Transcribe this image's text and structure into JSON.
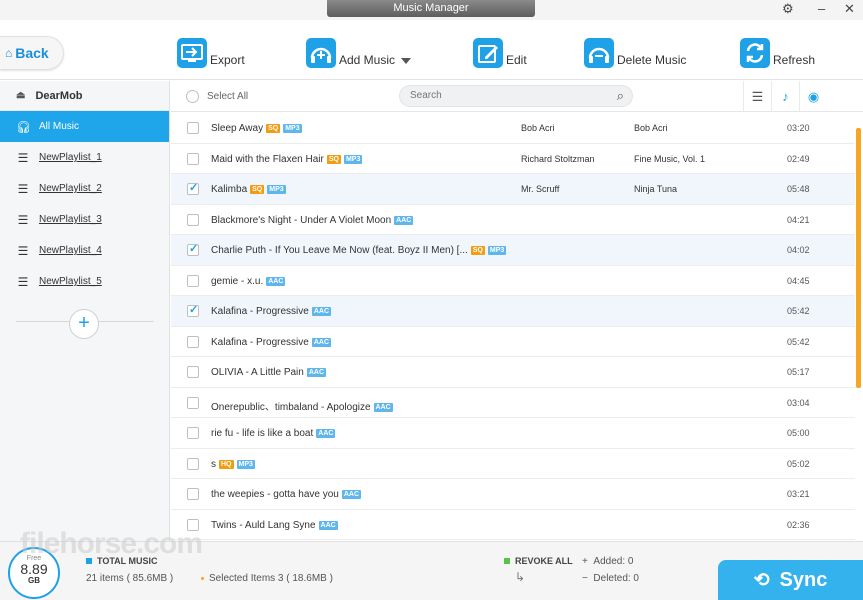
{
  "window": {
    "title": "Music Manager"
  },
  "toolbar": {
    "back_label": "Back",
    "export_label": "Export",
    "add_music_label": "Add Music",
    "edit_label": "Edit",
    "delete_music_label": "Delete Music",
    "refresh_label": "Refresh"
  },
  "sidebar": {
    "device_name": "DearMob",
    "items": [
      {
        "label": "All Music",
        "icon": "headphones-icon",
        "active": true
      },
      {
        "label": "NewPlaylist_1",
        "icon": "playlist-icon"
      },
      {
        "label": "NewPlaylist_2",
        "icon": "playlist-icon"
      },
      {
        "label": "NewPlaylist_3",
        "icon": "playlist-icon"
      },
      {
        "label": "NewPlaylist_4",
        "icon": "playlist-icon"
      },
      {
        "label": "NewPlaylist_5",
        "icon": "playlist-icon"
      }
    ]
  },
  "list": {
    "select_all_label": "Select All",
    "search_placeholder": "Search",
    "rows": [
      {
        "title": "Sleep Away",
        "badges": [
          "SQ",
          "MP3"
        ],
        "artist": "Bob Acri",
        "album": "Bob Acri",
        "duration": "03:20",
        "checked": false
      },
      {
        "title": "Maid with the Flaxen Hair",
        "badges": [
          "SQ",
          "MP3"
        ],
        "artist": "Richard Stoltzman",
        "album": "Fine Music, Vol. 1",
        "duration": "02:49",
        "checked": false
      },
      {
        "title": "Kalimba",
        "badges": [
          "SQ",
          "MP3"
        ],
        "artist": "Mr. Scruff",
        "album": "Ninja Tuna",
        "duration": "05:48",
        "checked": true
      },
      {
        "title": "Blackmore's Night - Under A Violet Moon",
        "badges": [
          "AAC"
        ],
        "artist": "",
        "album": "",
        "duration": "04:21",
        "checked": false
      },
      {
        "title": "Charlie Puth - If You Leave Me Now (feat. Boyz II Men) [...",
        "badges": [
          "SQ",
          "MP3"
        ],
        "artist": "",
        "album": "",
        "duration": "04:02",
        "checked": true
      },
      {
        "title": "gemie - x.u.",
        "badges": [
          "AAC"
        ],
        "artist": "",
        "album": "",
        "duration": "04:45",
        "checked": false
      },
      {
        "title": "Kalafina - Progressive",
        "badges": [
          "AAC"
        ],
        "artist": "",
        "album": "",
        "duration": "05:42",
        "checked": true
      },
      {
        "title": "Kalafina - Progressive",
        "badges": [
          "AAC"
        ],
        "artist": "",
        "album": "",
        "duration": "05:42",
        "checked": false
      },
      {
        "title": "OLIVIA - A Little Pain",
        "badges": [
          "AAC"
        ],
        "artist": "",
        "album": "",
        "duration": "05:17",
        "checked": false
      },
      {
        "title": "Onerepublic、timbaland - Apologize",
        "badges": [
          "AAC"
        ],
        "artist": "",
        "album": "",
        "duration": "03:04",
        "checked": false
      },
      {
        "title": "rie fu - life is like a boat",
        "badges": [
          "AAC"
        ],
        "artist": "",
        "album": "",
        "duration": "05:00",
        "checked": false
      },
      {
        "title": "s",
        "badges": [
          "HQ",
          "MP3"
        ],
        "artist": "",
        "album": "",
        "duration": "05:02",
        "checked": false
      },
      {
        "title": "the weepies - gotta have you",
        "badges": [
          "AAC"
        ],
        "artist": "",
        "album": "",
        "duration": "03:21",
        "checked": false
      },
      {
        "title": "Twins - Auld Lang Syne",
        "badges": [
          "AAC"
        ],
        "artist": "",
        "album": "",
        "duration": "02:36",
        "checked": false
      }
    ]
  },
  "footer": {
    "storage_free_label": "Free",
    "storage_free_value": "8.89",
    "storage_unit": "GB",
    "total_music_label": "TOTAL MUSIC",
    "items_text": "21 items ( 85.6MB )",
    "selected_text": "Selected Items 3 ( 18.6MB )",
    "revoke_all_label": "REVOKE ALL",
    "added_text": "Added: 0",
    "deleted_text": "Deleted: 0",
    "sync_label": "Sync"
  },
  "colors": {
    "accent": "#1ea1e6",
    "scrollbar": "#f5a623",
    "badge_quality": "#f39c12",
    "badge_format": "#5fb6ec",
    "revoke_green": "#57c445"
  },
  "watermark": "filehorse.com"
}
